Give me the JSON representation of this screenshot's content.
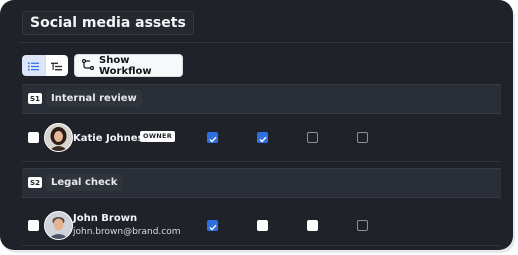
{
  "header": {
    "title": "Social media assets"
  },
  "toolbar": {
    "workflow_label": "Show Workflow"
  },
  "stages": [
    {
      "tag": "S1",
      "label": "Internal review",
      "person": {
        "name": "Katie Johnes",
        "badge": "OWNER",
        "email": ""
      },
      "permissions": [
        "checked",
        "checked",
        "empty",
        "empty"
      ]
    },
    {
      "tag": "S2",
      "label": "Legal check",
      "person": {
        "name": "John Brown",
        "badge": "",
        "email": "john.brown@brand.com"
      },
      "permissions": [
        "checked",
        "white",
        "white",
        "empty"
      ]
    }
  ],
  "colors": {
    "panel": "#1f2329",
    "accent": "#2f6fe0"
  },
  "icons": {
    "list_view": "list-icon",
    "tree_view": "indent-icon",
    "workflow": "workflow-icon",
    "check": "check-icon"
  }
}
